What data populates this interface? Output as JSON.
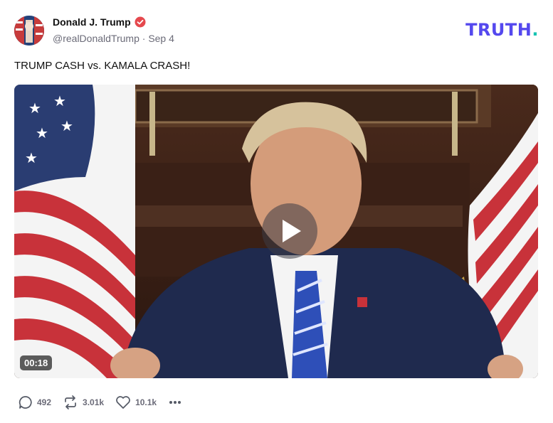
{
  "author": {
    "display_name": "Donald J. Trump",
    "handle": "@realDonaldTrump",
    "separator": "·",
    "date": "Sep 4",
    "verified_icon": "verified-badge-icon"
  },
  "brand": {
    "text": "TRUTH",
    "dot": "."
  },
  "post": {
    "text": "TRUMP CASH vs. KAMALA CRASH!"
  },
  "video": {
    "duration": "00:18",
    "play_icon": "play-icon"
  },
  "actions": {
    "replies": "492",
    "retruths": "3.01k",
    "likes": "10.1k",
    "more_icon": "more-icon"
  },
  "colors": {
    "brand": "#5448ee",
    "brand_dot": "#17c3b2",
    "verified": "#e5484d",
    "meta_gray": "#6b6b78"
  }
}
